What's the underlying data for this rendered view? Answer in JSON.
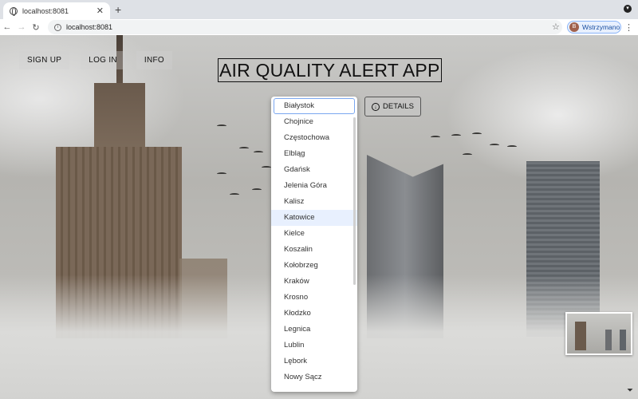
{
  "browser": {
    "tab_title": "localhost:8081",
    "tab_close": "✕",
    "new_tab": "+",
    "url": "localhost:8081",
    "profile_initial": "B",
    "profile_label": "Wstrzymano"
  },
  "nav": {
    "links": [
      "SIGN UP",
      "LOG IN",
      "INFO"
    ]
  },
  "app": {
    "title": "AIR QUALITY ALERT APP"
  },
  "city_dropdown": {
    "selected": "Białystok",
    "highlighted": "Katowice",
    "options": [
      "Białystok",
      "Chojnice",
      "Częstochowa",
      "Elbląg",
      "Gdańsk",
      "Jelenia Góra",
      "Kalisz",
      "Katowice",
      "Kielce",
      "Koszalin",
      "Kołobrzeg",
      "Kraków",
      "Krosno",
      "Kłodzko",
      "Legnica",
      "Lublin",
      "Lębork",
      "Nowy Sącz"
    ]
  },
  "details_button": {
    "label": "DETAILS",
    "icon": "download-circle-icon"
  },
  "colors": {
    "selected_border": "#7aa7f0",
    "hover_bg": "#e8f0fe",
    "profile_border": "#8ab4f8"
  }
}
